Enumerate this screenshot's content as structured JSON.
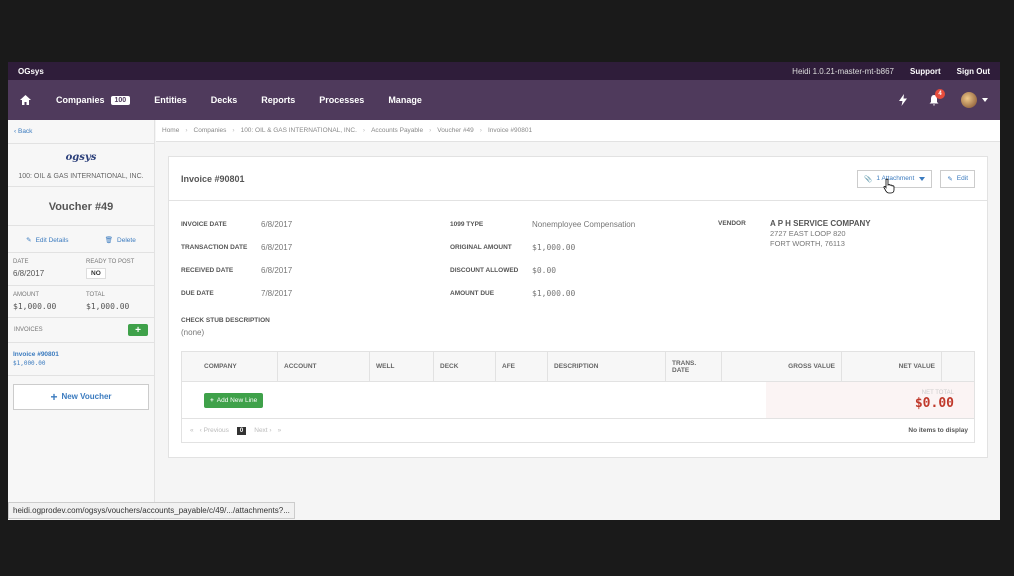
{
  "topbar": {
    "brand": "OGsys",
    "version": "Heidi 1.0.21-master-mt-b867",
    "support": "Support",
    "signout": "Sign Out"
  },
  "nav": {
    "companies": "Companies",
    "companies_count": "100",
    "entities": "Entities",
    "decks": "Decks",
    "reports": "Reports",
    "processes": "Processes",
    "manage": "Manage",
    "notifications_count": "4"
  },
  "sidebar": {
    "back": "Back",
    "logo": "ogsys",
    "company": "100: OIL & GAS INTERNATIONAL, INC.",
    "voucher": "Voucher #49",
    "edit_details": "Edit Details",
    "delete": "Delete",
    "date_label": "DATE",
    "date_value": "6/8/2017",
    "ready_label": "READY TO POST",
    "ready_value": "NO",
    "amount_label": "AMOUNT",
    "amount_value": "$1,000.00",
    "total_label": "TOTAL",
    "total_value": "$1,000.00",
    "invoices_label": "INVOICES",
    "invoice_link": "Invoice #90801",
    "invoice_amount": "$1,000.00",
    "new_voucher": "New Voucher"
  },
  "breadcrumb": [
    "Home",
    "Companies",
    "100: OIL & GAS INTERNATIONAL, INC.",
    "Accounts Payable",
    "Voucher #49",
    "Invoice #90801"
  ],
  "invoice": {
    "title": "Invoice #90801",
    "attachment_btn": "1 Attachment",
    "edit_btn": "Edit",
    "invoice_date_label": "INVOICE DATE",
    "invoice_date": "6/8/2017",
    "transaction_date_label": "TRANSACTION DATE",
    "transaction_date": "6/8/2017",
    "received_date_label": "RECEIVED DATE",
    "received_date": "6/8/2017",
    "due_date_label": "DUE DATE",
    "due_date": "7/8/2017",
    "type_1099_label": "1099 TYPE",
    "type_1099": "Nonemployee Compensation",
    "original_amount_label": "ORIGINAL AMOUNT",
    "original_amount": "$1,000.00",
    "discount_allowed_label": "DISCOUNT ALLOWED",
    "discount_allowed": "$0.00",
    "amount_due_label": "AMOUNT DUE",
    "amount_due": "$1,000.00",
    "vendor_label": "VENDOR",
    "vendor_name": "A P H SERVICE COMPANY",
    "vendor_addr1": "2727 EAST LOOP 820",
    "vendor_addr2": "FORT WORTH, 76113",
    "stub_label": "CHECK STUB DESCRIPTION",
    "stub_value": "(none)"
  },
  "lines_table": {
    "columns": [
      "COMPANY",
      "ACCOUNT",
      "WELL",
      "DECK",
      "AFE",
      "DESCRIPTION",
      "TRANS. DATE",
      "GROSS VALUE",
      "NET VALUE"
    ],
    "add_line": "Add New Line",
    "net_total_label": "NET TOTAL",
    "net_total_value": "$0.00",
    "prev": "Previous",
    "page": "0",
    "next": "Next",
    "empty": "No items to display"
  },
  "status_url": "heidi.ogprodev.com/ogsys/vouchers/accounts_payable/c/49/.../attachments?..."
}
